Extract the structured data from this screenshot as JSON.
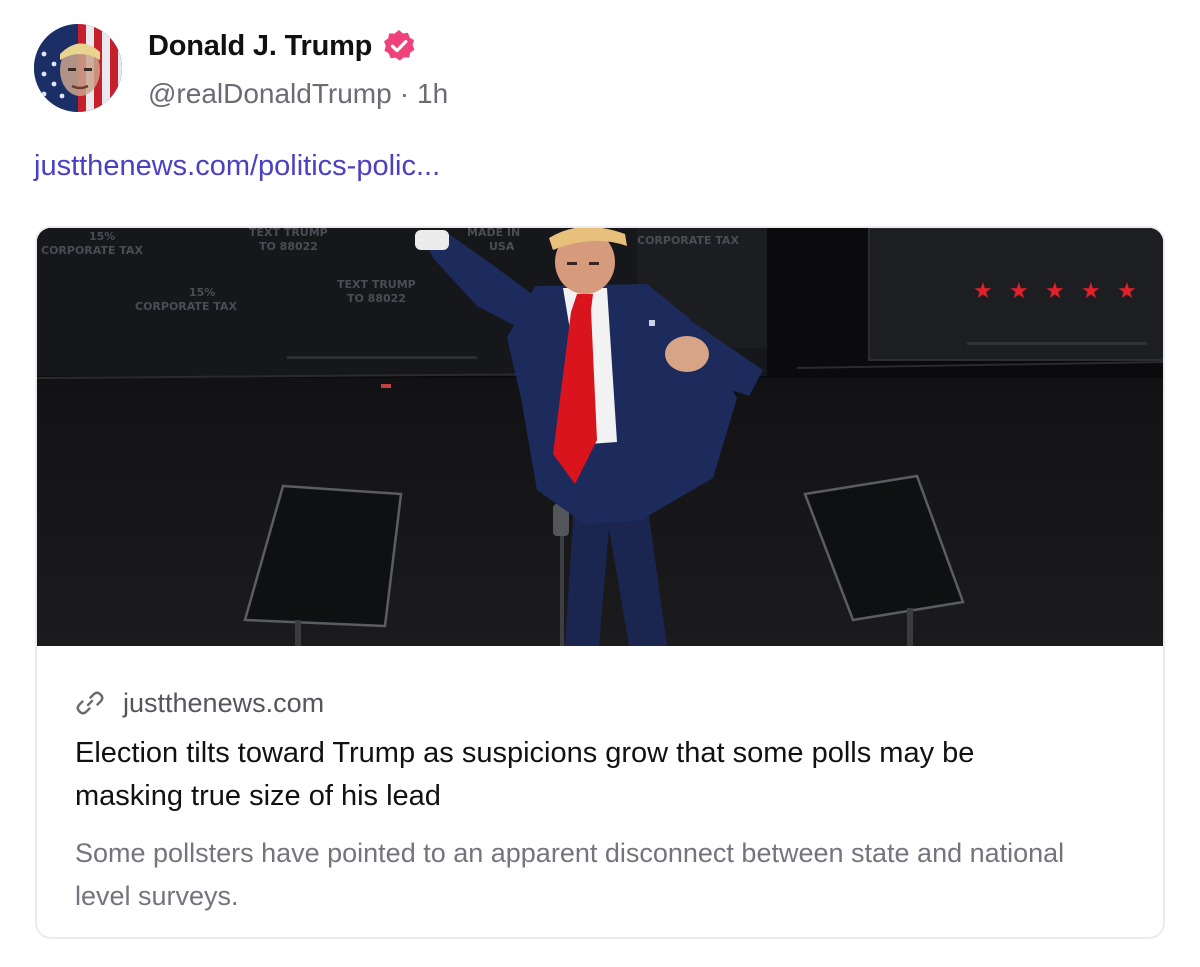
{
  "author": {
    "display_name": "Donald J. Trump",
    "handle": "@realDonaldTrump",
    "separator": "·",
    "time": "1h",
    "verified_badge_color": "#f0427a"
  },
  "post": {
    "link_text": "justthenews.com/politics-polic..."
  },
  "card": {
    "domain": "justthenews.com",
    "headline": "Election tilts toward Trump as suspicions grow that some polls may be masking true size of his lead",
    "description": "Some pollsters have pointed to an apparent disconnect between state and national level surveys.",
    "image_signs": {
      "corporate_tax_pct": "15%",
      "corporate_tax_label": "CORPORATE TAX",
      "text_trump": "TEXT TRUMP",
      "text_number": "TO 88022",
      "made_in": "MADE IN",
      "usa": "USA"
    }
  },
  "colors": {
    "link": "#4b3fc4",
    "muted_text": "#6b6b74",
    "tie_red": "#d9141c",
    "suit_navy": "#1c2a55"
  }
}
